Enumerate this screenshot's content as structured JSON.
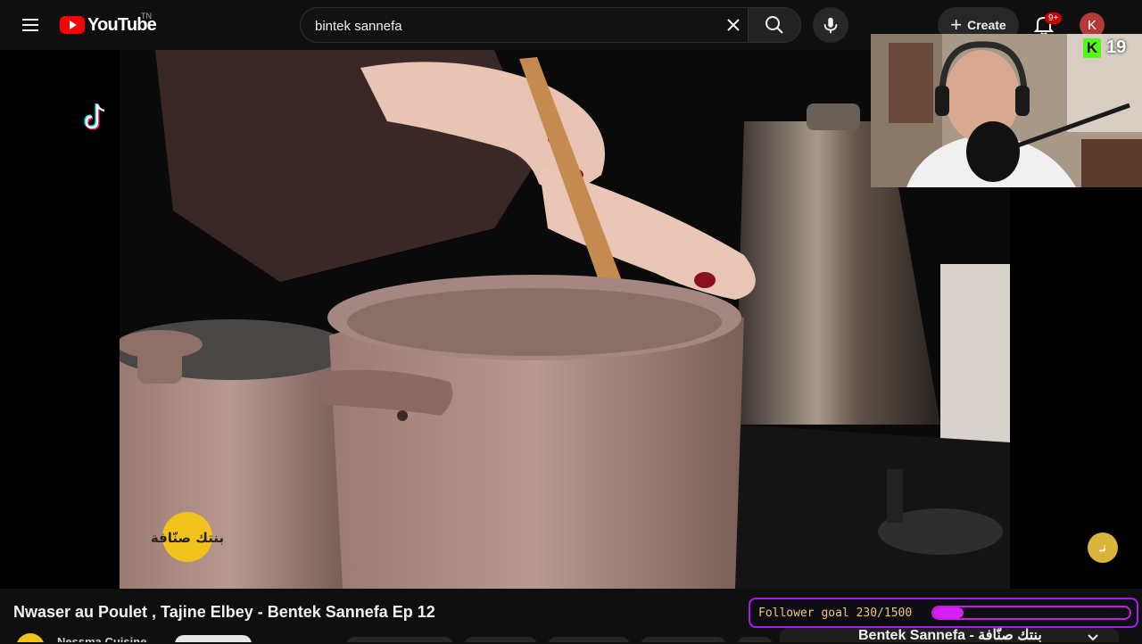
{
  "header": {
    "logo_text": "YouTube",
    "country_code": "TN",
    "search_value": "bintek sannefa",
    "create_label": "Create",
    "notification_count": "9+",
    "avatar_letter": "K"
  },
  "overlays": {
    "kick_viewers": "19",
    "follower_goal": {
      "label": "Follower goal 230/1500",
      "current": 230,
      "target": 1500
    }
  },
  "video": {
    "title": "Nwaser au Poulet , Tajine Elbey - Bentek Sannefa Ep 12",
    "channel_name": "Nessma Cuisine",
    "show_logo_text": "بنتك صنّافة",
    "channel_watermark": "نـ"
  },
  "playlist": {
    "title": "Bentek Sannefa - بنتك صنّافة"
  },
  "colors": {
    "accent_red": "#ff0000",
    "goal_border": "#a020f0",
    "goal_fill": "#d61ef5",
    "kick_green": "#53fc18"
  }
}
